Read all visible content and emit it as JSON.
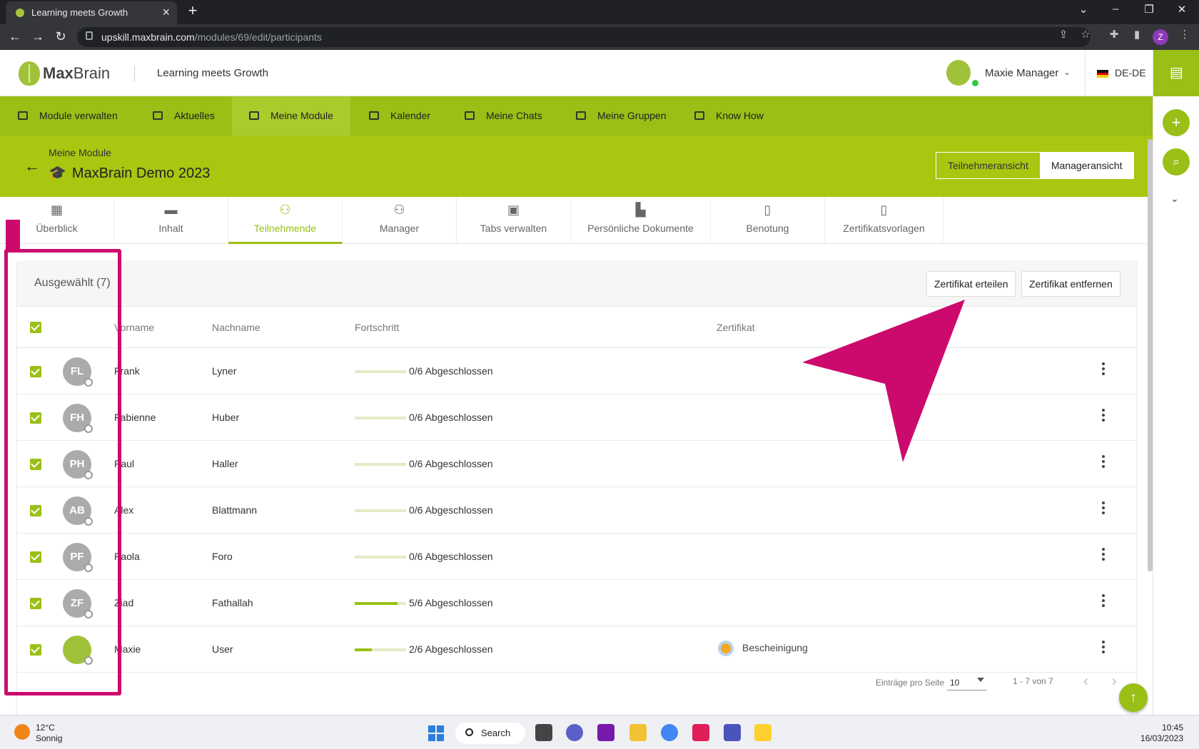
{
  "browser": {
    "tab_title": "Learning meets Growth",
    "url_host": "upskill.maxbrain.com",
    "url_path": "/modules/69/edit/participants",
    "profile_initial": "Z"
  },
  "header": {
    "brand_max": "Max",
    "brand_brain": "Brain",
    "tagline": "Learning meets Growth",
    "user_name": "Maxie Manager",
    "language": "DE-DE"
  },
  "nav": {
    "items": [
      {
        "label": "Module verwalten",
        "icon": "folder-user-icon"
      },
      {
        "label": "Aktuelles",
        "icon": "news-icon"
      },
      {
        "label": "Meine Module",
        "icon": "graduation-cap-icon"
      },
      {
        "label": "Kalender",
        "icon": "calendar-icon"
      },
      {
        "label": "Meine Chats",
        "icon": "chat-icon"
      },
      {
        "label": "Meine Gruppen",
        "icon": "group-icon"
      },
      {
        "label": "Know How",
        "icon": "book-icon"
      }
    ],
    "active": "Meine Module"
  },
  "module": {
    "breadcrumb": "Meine Module",
    "title": "MaxBrain Demo 2023",
    "view_participant": "Teilnehmeransicht",
    "view_manager": "Manageransicht"
  },
  "subtabs": [
    {
      "label": "Überblick",
      "icon": "dashboard-icon"
    },
    {
      "label": "Inhalt",
      "icon": "folder-icon"
    },
    {
      "label": "Teilnehmende",
      "icon": "people-icon"
    },
    {
      "label": "Manager",
      "icon": "manager-icon"
    },
    {
      "label": "Tabs verwalten",
      "icon": "window-icon"
    },
    {
      "label": "Persönliche Dokumente",
      "icon": "person-doc-icon"
    },
    {
      "label": "Benotung",
      "icon": "grade-doc-icon"
    },
    {
      "label": "Zertifikatsvorlagen",
      "icon": "doc-settings-icon"
    }
  ],
  "table": {
    "selected_label": "Ausgewählt (7)",
    "btn_issue": "Zertifikat erteilen",
    "btn_remove": "Zertifikat entfernen",
    "columns": {
      "first": "Vorname",
      "last": "Nachname",
      "progress": "Fortschritt",
      "cert": "Zertifikat"
    },
    "rows": [
      {
        "initials": "FL",
        "first": "Frank",
        "last": "Lyner",
        "progress": 0,
        "progress_text": "0/6 Abgeschlossen",
        "cert": ""
      },
      {
        "initials": "FH",
        "first": "Fabienne",
        "last": "Huber",
        "progress": 0,
        "progress_text": "0/6 Abgeschlossen",
        "cert": ""
      },
      {
        "initials": "PH",
        "first": "Paul",
        "last": "Haller",
        "progress": 0,
        "progress_text": "0/6 Abgeschlossen",
        "cert": ""
      },
      {
        "initials": "AB",
        "first": "Alex",
        "last": "Blattmann",
        "progress": 0,
        "progress_text": "0/6 Abgeschlossen",
        "cert": ""
      },
      {
        "initials": "PF",
        "first": "Paola",
        "last": "Foro",
        "progress": 0,
        "progress_text": "0/6 Abgeschlossen",
        "cert": ""
      },
      {
        "initials": "ZF",
        "first": "Ziad",
        "last": "Fathallah",
        "progress": 0.833,
        "progress_text": "5/6 Abgeschlossen",
        "cert": ""
      },
      {
        "initials": "",
        "first": "Maxie",
        "last": "User",
        "progress": 0.333,
        "progress_text": "2/6 Abgeschlossen",
        "cert": "Bescheinigung"
      }
    ],
    "pager": {
      "label": "Einträge pro Seite",
      "per_page": "10",
      "range": "1 - 7 von 7"
    }
  },
  "taskbar": {
    "temp": "12°C",
    "weather": "Sonnig",
    "search": "Search",
    "time": "10:45",
    "date": "16/03/2023"
  },
  "colors": {
    "accent": "#9abf16",
    "annotation": "#cc0a6e"
  }
}
